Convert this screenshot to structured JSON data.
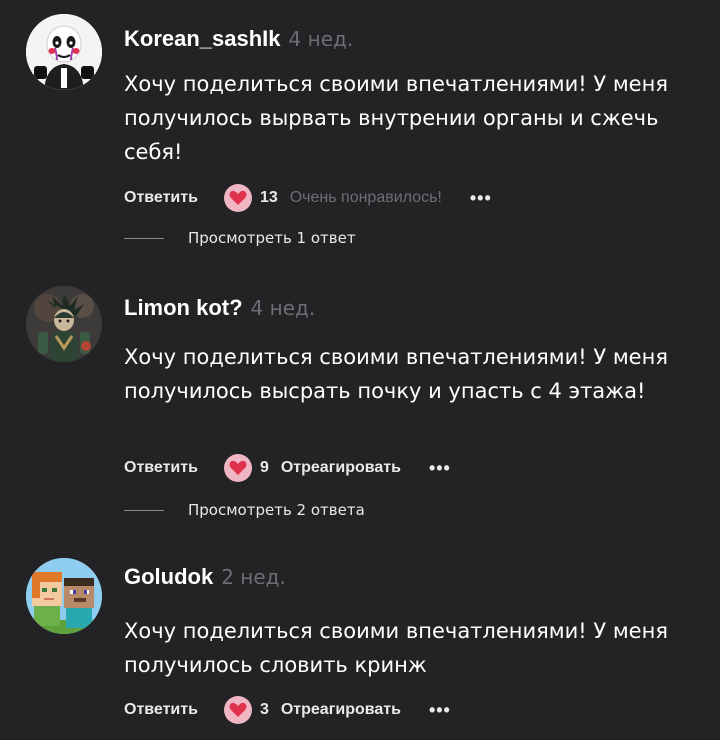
{
  "colors": {
    "background": "#232225",
    "muted": "#6e6d72",
    "heart_bg": "#f0b6c4",
    "heart": "#e0324e"
  },
  "comments": [
    {
      "avatar": "puppet-avatar",
      "username": "Korean_sashIk",
      "time": "4 нед.",
      "text": "Хочу поделиться своими впечатлениями! У меня получилось вырвать внутрении органы и сжечь себя!",
      "reply_label": "Ответить",
      "reaction_icon": "heart-icon",
      "reaction_count": "13",
      "reaction_label": "Очень понравилось!",
      "more_icon": "ellipsis-icon",
      "view_replies": "Просмотреть 1 ответ"
    },
    {
      "avatar": "knight-avatar",
      "username": "Limon kot?",
      "time": "4 нед.",
      "text": "Хочу поделиться своими впечатлениями! У меня получилось высрать почку и упасть с 4 этажа!",
      "reply_label": "Ответить",
      "reaction_icon": "heart-icon",
      "reaction_count": "9",
      "reaction_label": "Отреагировать",
      "more_icon": "ellipsis-icon",
      "view_replies": "Просмотреть 2 ответа"
    },
    {
      "avatar": "minecraft-avatar",
      "username": "Goludok",
      "time": "2 нед.",
      "text": "Хочу поделиться своими впечатлениями! У меня получилось словить кринж",
      "reply_label": "Ответить",
      "reaction_icon": "heart-icon",
      "reaction_count": "3",
      "reaction_label": "Отреагировать",
      "more_icon": "ellipsis-icon"
    }
  ]
}
